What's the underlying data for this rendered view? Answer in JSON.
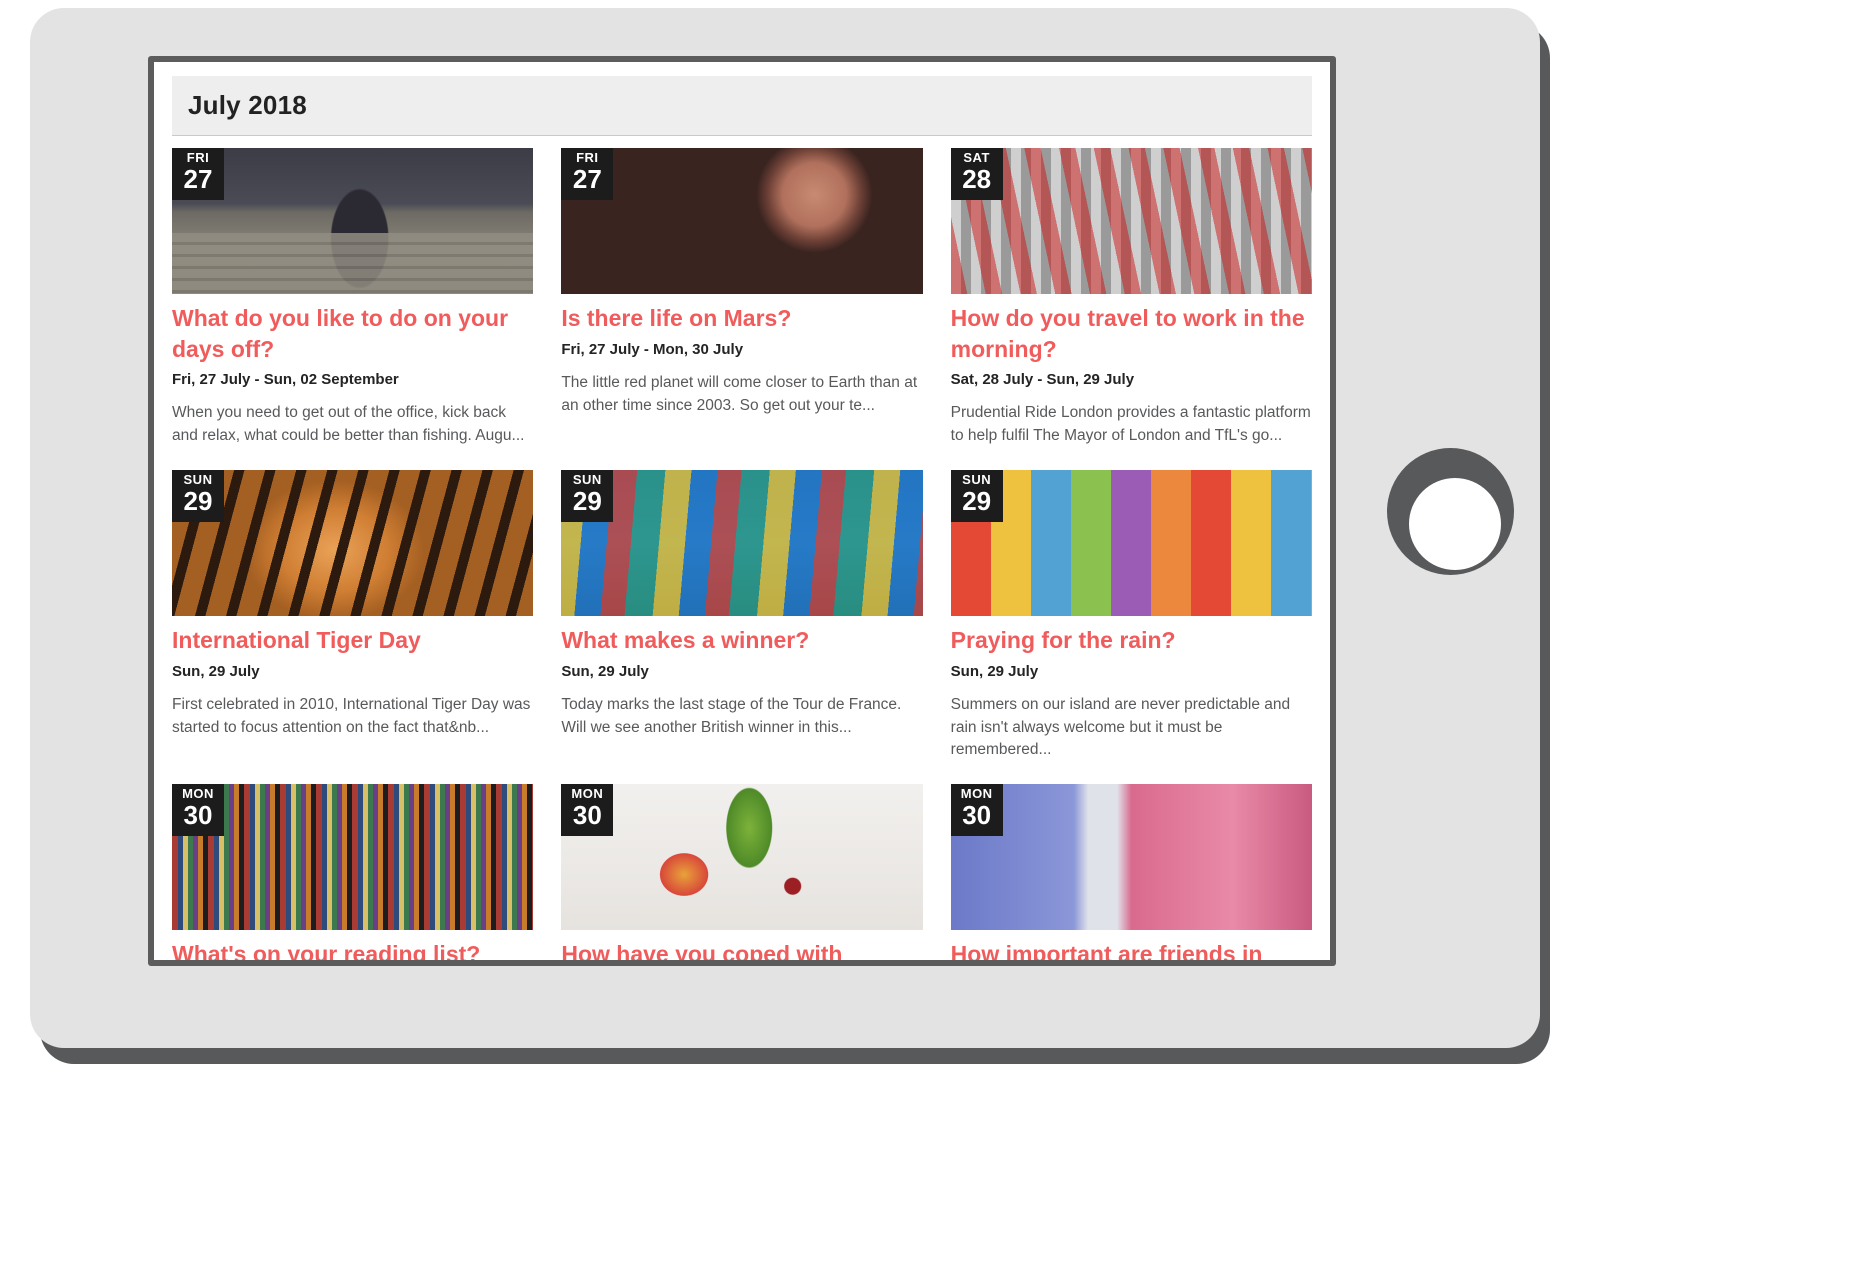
{
  "device": {
    "home_button_label": "home-button"
  },
  "header": {
    "month_title": "July 2018"
  },
  "cards": [
    {
      "dow": "FRI",
      "day": "27",
      "title": "What do you like to do on your days off?",
      "dates": "Fri, 27 July - Sun, 02 September",
      "desc": "When you need to get out of the office, kick back and relax, what could be better than fishing. Augu...",
      "photo": "ph-pier",
      "photo_name": "pier-woman-photo"
    },
    {
      "dow": "FRI",
      "day": "27",
      "title": "Is there life on Mars?",
      "dates": "Fri, 27 July - Mon, 30 July",
      "desc": "The little red planet will come closer to Earth than at an other time since 2003. So get out your te...",
      "photo": "ph-mars",
      "photo_name": "mars-planet-photo"
    },
    {
      "dow": "SAT",
      "day": "28",
      "title": "How do you travel to work in the morning?",
      "dates": "Sat, 28 July - Sun, 29 July",
      "desc": "Prudential Ride London provides a fantastic platform to help fulfil The Mayor of London and TfL's go...",
      "photo": "ph-bikes",
      "photo_name": "bicycle-parking-photo"
    },
    {
      "dow": "SUN",
      "day": "29",
      "title": "International Tiger Day",
      "dates": "Sun, 29 July",
      "desc": "First celebrated in 2010, International Tiger Day was started to focus attention on the fact that&nb...",
      "photo": "ph-tiger",
      "photo_name": "tiger-photo"
    },
    {
      "dow": "SUN",
      "day": "29",
      "title": "What makes a winner?",
      "dates": "Sun, 29 July",
      "desc": "Today marks the last stage of the Tour de France. Will we see another British winner in this...",
      "photo": "ph-cycle",
      "photo_name": "cyclists-photo"
    },
    {
      "dow": "SUN",
      "day": "29",
      "title": "Praying for the rain?",
      "dates": "Sun, 29 July",
      "desc": "Summers on our island are never predictable and rain isn't always welcome but it must be remembered...",
      "photo": "ph-umbrellas",
      "photo_name": "umbrellas-photo"
    },
    {
      "dow": "MON",
      "day": "30",
      "title": "What's on your reading list?",
      "dates": "",
      "desc": "",
      "photo": "ph-books",
      "photo_name": "bookshelf-photo"
    },
    {
      "dow": "MON",
      "day": "30",
      "title": "How have you coped with sickness",
      "dates": "",
      "desc": "",
      "photo": "ph-health",
      "photo_name": "stethoscope-fruit-photo"
    },
    {
      "dow": "MON",
      "day": "30",
      "title": "How important are friends in",
      "dates": "",
      "desc": "",
      "photo": "ph-friends",
      "photo_name": "friends-shirts-photo"
    }
  ],
  "colors": {
    "title_accent": "#f05c5c",
    "badge_bg": "#1c1c1c",
    "header_bg": "#eeeeee",
    "body_text": "#58595b"
  }
}
